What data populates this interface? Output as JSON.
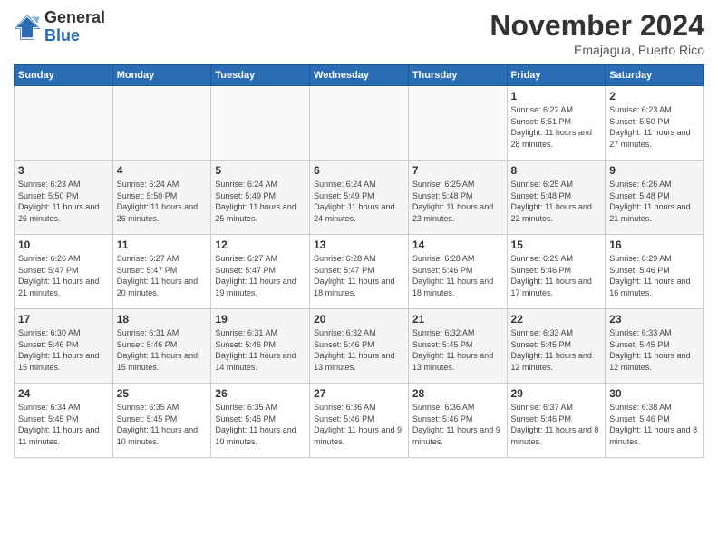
{
  "header": {
    "logo_general": "General",
    "logo_blue": "Blue",
    "month_title": "November 2024",
    "location": "Emajagua, Puerto Rico"
  },
  "weekdays": [
    "Sunday",
    "Monday",
    "Tuesday",
    "Wednesday",
    "Thursday",
    "Friday",
    "Saturday"
  ],
  "weeks": [
    [
      {
        "day": "",
        "info": ""
      },
      {
        "day": "",
        "info": ""
      },
      {
        "day": "",
        "info": ""
      },
      {
        "day": "",
        "info": ""
      },
      {
        "day": "",
        "info": ""
      },
      {
        "day": "1",
        "info": "Sunrise: 6:22 AM\nSunset: 5:51 PM\nDaylight: 11 hours and 28 minutes."
      },
      {
        "day": "2",
        "info": "Sunrise: 6:23 AM\nSunset: 5:50 PM\nDaylight: 11 hours and 27 minutes."
      }
    ],
    [
      {
        "day": "3",
        "info": "Sunrise: 6:23 AM\nSunset: 5:50 PM\nDaylight: 11 hours and 26 minutes."
      },
      {
        "day": "4",
        "info": "Sunrise: 6:24 AM\nSunset: 5:50 PM\nDaylight: 11 hours and 26 minutes."
      },
      {
        "day": "5",
        "info": "Sunrise: 6:24 AM\nSunset: 5:49 PM\nDaylight: 11 hours and 25 minutes."
      },
      {
        "day": "6",
        "info": "Sunrise: 6:24 AM\nSunset: 5:49 PM\nDaylight: 11 hours and 24 minutes."
      },
      {
        "day": "7",
        "info": "Sunrise: 6:25 AM\nSunset: 5:48 PM\nDaylight: 11 hours and 23 minutes."
      },
      {
        "day": "8",
        "info": "Sunrise: 6:25 AM\nSunset: 5:48 PM\nDaylight: 11 hours and 22 minutes."
      },
      {
        "day": "9",
        "info": "Sunrise: 6:26 AM\nSunset: 5:48 PM\nDaylight: 11 hours and 21 minutes."
      }
    ],
    [
      {
        "day": "10",
        "info": "Sunrise: 6:26 AM\nSunset: 5:47 PM\nDaylight: 11 hours and 21 minutes."
      },
      {
        "day": "11",
        "info": "Sunrise: 6:27 AM\nSunset: 5:47 PM\nDaylight: 11 hours and 20 minutes."
      },
      {
        "day": "12",
        "info": "Sunrise: 6:27 AM\nSunset: 5:47 PM\nDaylight: 11 hours and 19 minutes."
      },
      {
        "day": "13",
        "info": "Sunrise: 6:28 AM\nSunset: 5:47 PM\nDaylight: 11 hours and 18 minutes."
      },
      {
        "day": "14",
        "info": "Sunrise: 6:28 AM\nSunset: 5:46 PM\nDaylight: 11 hours and 18 minutes."
      },
      {
        "day": "15",
        "info": "Sunrise: 6:29 AM\nSunset: 5:46 PM\nDaylight: 11 hours and 17 minutes."
      },
      {
        "day": "16",
        "info": "Sunrise: 6:29 AM\nSunset: 5:46 PM\nDaylight: 11 hours and 16 minutes."
      }
    ],
    [
      {
        "day": "17",
        "info": "Sunrise: 6:30 AM\nSunset: 5:46 PM\nDaylight: 11 hours and 15 minutes."
      },
      {
        "day": "18",
        "info": "Sunrise: 6:31 AM\nSunset: 5:46 PM\nDaylight: 11 hours and 15 minutes."
      },
      {
        "day": "19",
        "info": "Sunrise: 6:31 AM\nSunset: 5:46 PM\nDaylight: 11 hours and 14 minutes."
      },
      {
        "day": "20",
        "info": "Sunrise: 6:32 AM\nSunset: 5:46 PM\nDaylight: 11 hours and 13 minutes."
      },
      {
        "day": "21",
        "info": "Sunrise: 6:32 AM\nSunset: 5:45 PM\nDaylight: 11 hours and 13 minutes."
      },
      {
        "day": "22",
        "info": "Sunrise: 6:33 AM\nSunset: 5:45 PM\nDaylight: 11 hours and 12 minutes."
      },
      {
        "day": "23",
        "info": "Sunrise: 6:33 AM\nSunset: 5:45 PM\nDaylight: 11 hours and 12 minutes."
      }
    ],
    [
      {
        "day": "24",
        "info": "Sunrise: 6:34 AM\nSunset: 5:45 PM\nDaylight: 11 hours and 11 minutes."
      },
      {
        "day": "25",
        "info": "Sunrise: 6:35 AM\nSunset: 5:45 PM\nDaylight: 11 hours and 10 minutes."
      },
      {
        "day": "26",
        "info": "Sunrise: 6:35 AM\nSunset: 5:45 PM\nDaylight: 11 hours and 10 minutes."
      },
      {
        "day": "27",
        "info": "Sunrise: 6:36 AM\nSunset: 5:46 PM\nDaylight: 11 hours and 9 minutes."
      },
      {
        "day": "28",
        "info": "Sunrise: 6:36 AM\nSunset: 5:46 PM\nDaylight: 11 hours and 9 minutes."
      },
      {
        "day": "29",
        "info": "Sunrise: 6:37 AM\nSunset: 5:46 PM\nDaylight: 11 hours and 8 minutes."
      },
      {
        "day": "30",
        "info": "Sunrise: 6:38 AM\nSunset: 5:46 PM\nDaylight: 11 hours and 8 minutes."
      }
    ]
  ]
}
